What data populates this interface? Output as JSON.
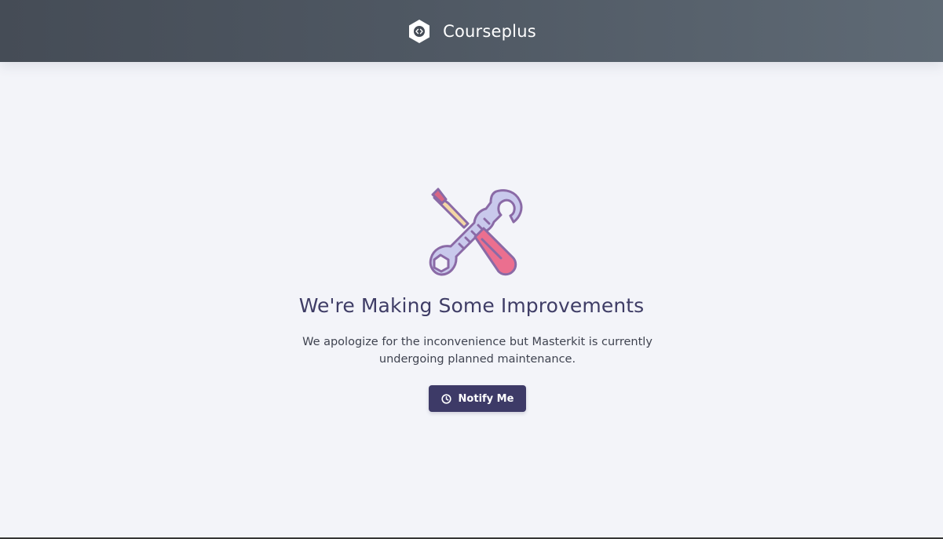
{
  "header": {
    "brand_name": "Courseplus",
    "logo_icon": "hexagon-code-icon"
  },
  "maintenance": {
    "illustration": "wrench-screwdriver-icon",
    "title": "We're Making Some Improvements",
    "message": "We apologize for the inconvenience but Masterkit is currently undergoing planned maintenance.",
    "button_label": "Notify Me",
    "button_icon": "clock-icon"
  },
  "colors": {
    "header_start": "#454c56",
    "header_end": "#5f6a75",
    "background": "#f3f4f9",
    "headline": "#3f3d66",
    "button": "#3d3a67",
    "wrench": "#c9c9ec",
    "screwdriver_handle": "#eb6f8f",
    "outline": "#8a6aa6"
  }
}
